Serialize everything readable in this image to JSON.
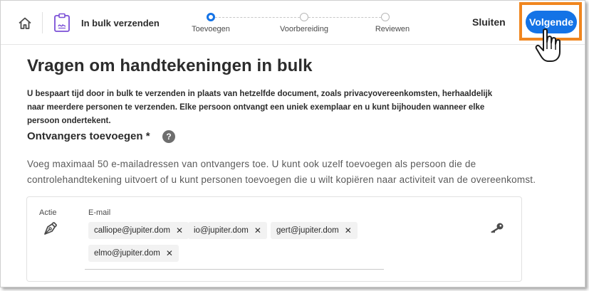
{
  "header": {
    "title": "In bulk verzenden",
    "close_label": "Sluiten",
    "next_label": "Volgende"
  },
  "steps": [
    {
      "label": "Toevoegen",
      "active": true
    },
    {
      "label": "Voorbereiding",
      "active": false
    },
    {
      "label": "Reviewen",
      "active": false
    }
  ],
  "main": {
    "title": "Vragen om handtekeningen in bulk",
    "intro_lines": [
      "U bespaart tijd door in bulk te verzenden in plaats van hetzelfde document, zoals privacyovereenkomsten, herhaaldelijk",
      "naar meerdere personen te verzenden. Elke persoon ontvangt een uniek exemplaar en u kunt bijhouden wanneer elke",
      "persoon ondertekent."
    ],
    "section_title": "Ontvangers toevoegen *",
    "help_glyph": "?",
    "desc_lines": [
      "Voeg maximaal 50 e-mailadressen van ontvangers toe. U kunt ook uzelf toevoegen als persoon die de",
      "controlehandtekening uitvoert of u kunt personen toevoegen die u wilt kopiëren naar activiteit van de overeenkomst."
    ]
  },
  "recipient": {
    "action_label": "Actie",
    "email_label": "E-mail",
    "remove_glyph": "✕",
    "emails": [
      "calliope@jupiter.dom",
      "io@jupiter.dom",
      "gert@jupiter.dom",
      "elmo@jupiter.dom"
    ]
  },
  "icons": [
    "home-icon",
    "document-icon",
    "help-icon",
    "pen-icon",
    "key-icon",
    "hand-cursor-icon"
  ],
  "colors": {
    "accent": "#1473e6",
    "highlight": "#f0861f"
  }
}
